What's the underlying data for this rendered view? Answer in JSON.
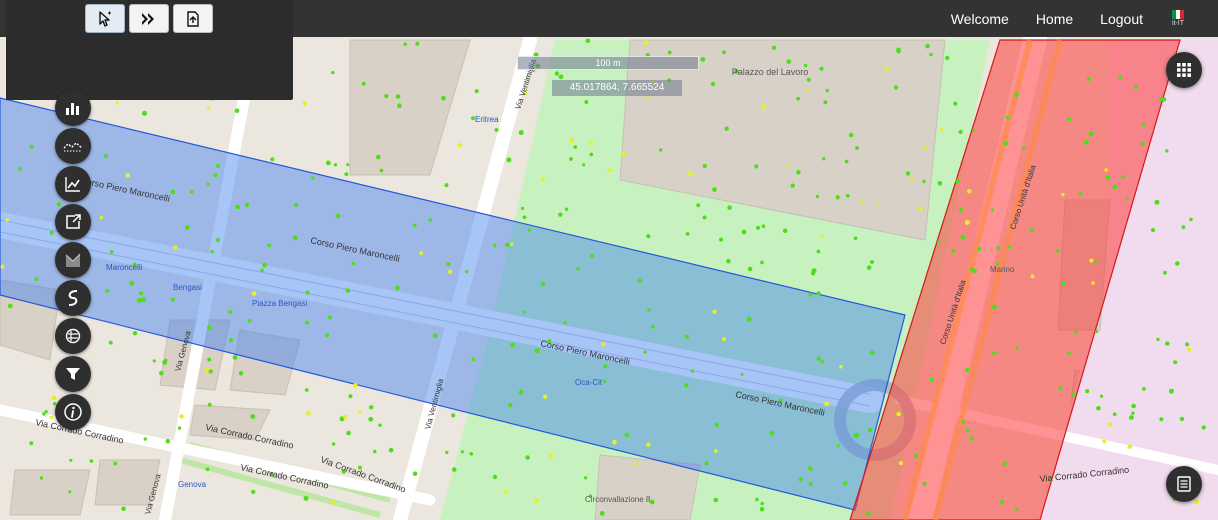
{
  "nav": {
    "welcome": "Welcome",
    "home": "Home",
    "logout": "Logout",
    "lang_code": "it-IT"
  },
  "toolbar": {
    "tools": [
      {
        "icon": "pointer-select-icon"
      },
      {
        "icon": "forward-arrows-icon"
      },
      {
        "icon": "import-file-icon"
      }
    ]
  },
  "left_tools": [
    {
      "icon": "bar-chart-icon"
    },
    {
      "icon": "heatmap-icon"
    },
    {
      "icon": "line-chart-icon"
    },
    {
      "icon": "export-icon"
    },
    {
      "icon": "shaded-area-icon"
    },
    {
      "icon": "route-icon"
    },
    {
      "icon": "traffic-flow-icon"
    },
    {
      "icon": "filter-icon"
    },
    {
      "icon": "info-icon"
    }
  ],
  "map": {
    "scale_text": "100 m",
    "coordinates": "45.017864, 7.665524",
    "labels": {
      "corso_piero_maroncelli": "Corso Piero Maroncelli",
      "corso_unita_italia": "Corso Unità d'Italia",
      "via_corrado_corradino": "Via Corrado Corradino",
      "via_genova": "Via Genova",
      "via_ventimiglia": "Via Ventimiglia",
      "palazzo_del_lavoro": "Palazzo del Lavoro",
      "maroncelli": "Maroncelli",
      "bengasi": "Bengasi",
      "piazza_bengasi": "Piazza Bengasi",
      "genova": "Genova",
      "oca_cit": "Oca-Cit",
      "circonvallazione": "Circonvallazione 8",
      "eritrea": "Eritrea",
      "marino": "Marino"
    },
    "colors": {
      "selection_blue": "#3d7ff0",
      "selection_red": "#ff3b3b",
      "park_green": "#c7f2c0",
      "sensor_green": "#4fdd1a",
      "sensor_yellow": "#e8f020"
    }
  },
  "right_controls": [
    {
      "icon": "grid-menu-icon"
    },
    {
      "icon": "legend-icon"
    }
  ]
}
